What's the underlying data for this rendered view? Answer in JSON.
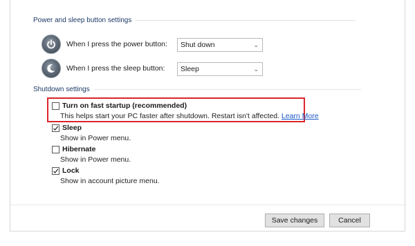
{
  "power_section": {
    "header": "Power and sleep button settings",
    "power_button_label": "When I press the power button:",
    "power_button_value": "Shut down",
    "sleep_button_label": "When I press the sleep button:",
    "sleep_button_value": "Sleep",
    "power_icon": "power-icon",
    "sleep_icon": "sleep-moon-icon"
  },
  "shutdown_section": {
    "header": "Shutdown settings",
    "options": [
      {
        "title": "Turn on fast startup (recommended)",
        "description": "This helps start your PC faster after shutdown. Restart isn't affected.",
        "link": "Learn More",
        "checked": false
      },
      {
        "title": "Sleep",
        "description": "Show in Power menu.",
        "checked": true
      },
      {
        "title": "Hibernate",
        "description": "Show in Power menu.",
        "checked": false
      },
      {
        "title": "Lock",
        "description": "Show in account picture menu.",
        "checked": true
      }
    ]
  },
  "footer": {
    "save_label": "Save changes",
    "cancel_label": "Cancel"
  },
  "colors": {
    "highlight_border": "#d9262c",
    "link": "#1a56c4",
    "section_header": "#1e3a66"
  }
}
